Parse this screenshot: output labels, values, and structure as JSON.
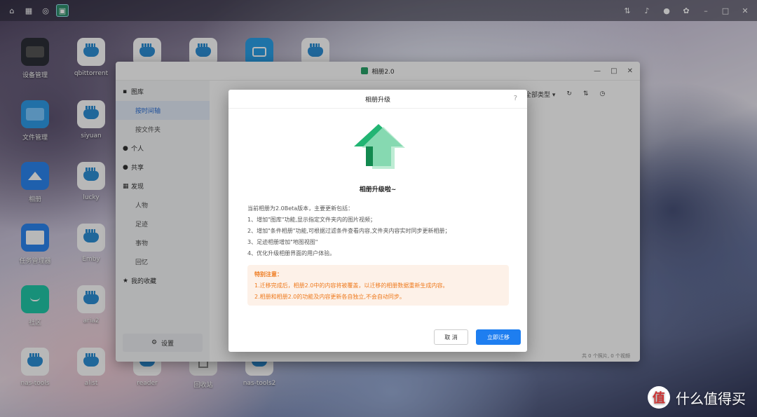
{
  "window": {
    "title": "相册2.0",
    "status": "共 0 个照片, 0 个视频"
  },
  "toolbar": {
    "filter_label": "全部类型"
  },
  "sidebar": {
    "items": [
      {
        "label": "图库",
        "icon": "camera-icon"
      },
      {
        "label": "按时间轴",
        "icon": ""
      },
      {
        "label": "按文件夹",
        "icon": ""
      },
      {
        "label": "个人",
        "icon": "person-icon"
      },
      {
        "label": "共享",
        "icon": "people-icon"
      },
      {
        "label": "发现",
        "icon": "grid-icon"
      },
      {
        "label": "人物",
        "icon": ""
      },
      {
        "label": "足迹",
        "icon": ""
      },
      {
        "label": "事物",
        "icon": ""
      },
      {
        "label": "回忆",
        "icon": ""
      },
      {
        "label": "我的收藏",
        "icon": "star-icon"
      }
    ],
    "settings_label": "设置"
  },
  "desktop": {
    "icons": [
      {
        "label": "设备管理",
        "icon": "device-manager-icon"
      },
      {
        "label": "qbittorrent",
        "icon": "docker-icon"
      },
      {
        "label": "文件管理",
        "icon": "folder-icon"
      },
      {
        "label": "siyuan",
        "icon": "docker-icon"
      },
      {
        "label": "相册",
        "icon": "photo-icon"
      },
      {
        "label": "lucky",
        "icon": "docker-icon"
      },
      {
        "label": "任务管理器",
        "icon": "task-manager-icon"
      },
      {
        "label": "Emby",
        "icon": "docker-icon"
      },
      {
        "label": "社区",
        "icon": "community-icon"
      },
      {
        "label": "aria2",
        "icon": "docker-icon"
      },
      {
        "label": "nas-tools",
        "icon": "docker-icon"
      },
      {
        "label": "alist",
        "icon": "docker-icon"
      },
      {
        "label": "reader",
        "icon": "docker-icon"
      },
      {
        "label": "回收站",
        "icon": "trash-icon"
      },
      {
        "label": "nas-tools2",
        "icon": "docker-icon"
      }
    ]
  },
  "dialog": {
    "title": "相册升级",
    "help": "?",
    "heading": "相册升级啦~",
    "intro": "当前相册为2.0Beta版本，主要更新包括：",
    "items": [
      "1、增加\"图库\"功能,显示指定文件夹内的图片视频；",
      "2、增加\"条件相册\"功能,可根据过滤条件查看内容,文件夹内容实时同步更新相册；",
      "3、足迹相册增加\"地图视图\"",
      "4、优化升级相册界面的用户体验。"
    ],
    "notice": {
      "title": "特别注意：",
      "lines": [
        "1.迁移完成后，相册2.0中的内容将被覆盖，以迁移的相册数据重新生成内容。",
        "2.相册和相册2.0的功能及内容更新各自独立,不会自动同步。"
      ]
    },
    "cancel_label": "取 消",
    "confirm_label": "立即迁移"
  },
  "watermark": {
    "text": "什么值得买",
    "logo": "值"
  },
  "colors": {
    "primary": "#1e7ef0",
    "notice_text": "#ee7a1e",
    "notice_bg": "#fdf1e8",
    "arrow_green": "#22b573"
  }
}
